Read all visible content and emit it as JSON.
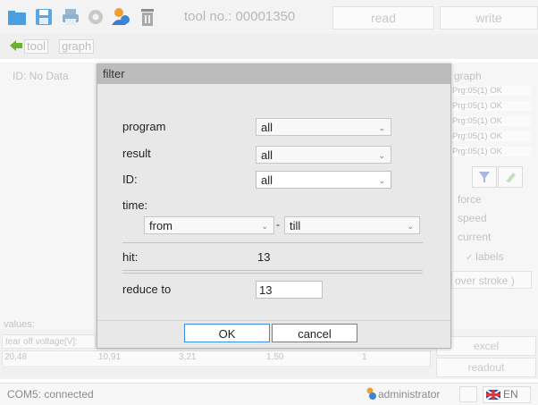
{
  "toolbar": {
    "tool_no": "tool no.: 00001350",
    "read_label": "read",
    "write_label": "write"
  },
  "nav": {
    "tool_link": "tool",
    "graph_link": "graph"
  },
  "left_panel": {
    "id_text": "ID: No Data",
    "values_label": "values:",
    "tear_off_label": "tear off voltage[V]:",
    "values": [
      "20,48",
      "10,91",
      "3,21",
      "1,50",
      "1"
    ]
  },
  "right_panel": {
    "graph_label": "graph",
    "graph_items": [
      "Prg:05(1) OK",
      "Prg:05(1) OK",
      "Prg:05(1) OK",
      "Prg:05(1) OK",
      "Prg:05(1) OK"
    ],
    "force": "force",
    "speed": "speed",
    "current": "current",
    "labels": "labels",
    "over_stroke": "over stroke )",
    "excel": "excel",
    "readout": "readout"
  },
  "dialog": {
    "title": "filter",
    "program_label": "program",
    "program_value": "all",
    "result_label": "result",
    "result_value": "all",
    "id_label": "ID:",
    "id_value": "all",
    "time_label": "time:",
    "from_value": "from",
    "dash": "-",
    "till_value": "till",
    "hit_label": "hit:",
    "hit_value": "13",
    "reduce_label": "reduce to",
    "reduce_value": "13",
    "ok_label": "OK",
    "cancel_label": "cancel"
  },
  "status": {
    "connection": "COM5: connected",
    "user": "administrator",
    "language": "EN"
  },
  "colors": {
    "accent_blue": "#3f8ede",
    "dialog_title_bg": "#bcbcbc"
  }
}
